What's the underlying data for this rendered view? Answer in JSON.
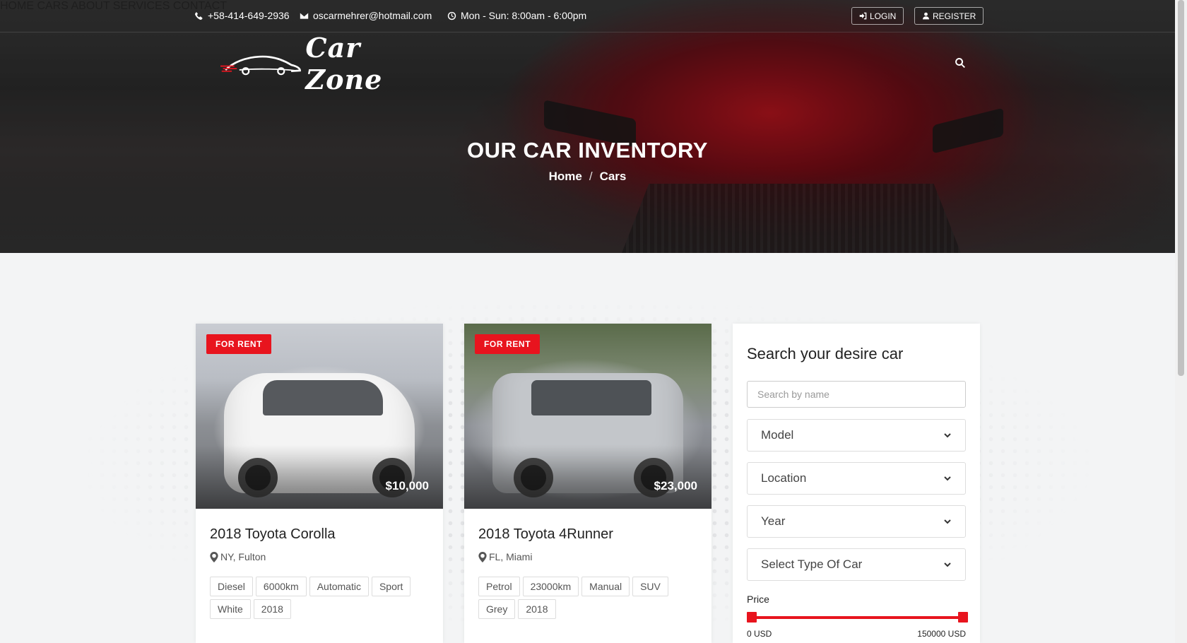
{
  "topbar": {
    "phone": "+58-414-649-2936",
    "email": "oscarmehrer@hotmail.com",
    "hours": "Mon - Sun: 8:00am - 6:00pm",
    "login_label": "LOGIN",
    "register_label": "REGISTER"
  },
  "brand": {
    "name": "Car Zone"
  },
  "nav": {
    "items": [
      "HOME",
      "CARS",
      "ABOUT",
      "SERVICES",
      "CONTACT"
    ]
  },
  "hero": {
    "title": "OUR CAR INVENTORY",
    "breadcrumb": [
      "Home",
      "Cars"
    ],
    "breadcrumb_separator": "/"
  },
  "cars": [
    {
      "badge": "FOR RENT",
      "price": "$10,000",
      "title": "2018 Toyota Corolla",
      "location": "NY, Fulton",
      "tags": [
        "Diesel",
        "6000km",
        "Automatic",
        "Sport",
        "White",
        "2018"
      ]
    },
    {
      "badge": "FOR RENT",
      "price": "$23,000",
      "title": "2018 Toyota 4Runner",
      "location": "FL, Miami",
      "tags": [
        "Petrol",
        "23000km",
        "Manual",
        "SUV",
        "Grey",
        "2018"
      ]
    }
  ],
  "search": {
    "heading": "Search your desire car",
    "name_placeholder": "Search by name",
    "model_selected": "Model",
    "location_selected": "Location",
    "year_selected": "Year",
    "type_selected": "Select Type Of Car",
    "price_label": "Price",
    "price_min_label": "0 USD",
    "price_max_label": "150000 USD",
    "price_min_fraction": 0,
    "price_max_fraction": 1
  },
  "colors": {
    "accent": "#e8141e",
    "panel_bg": "#ffffff",
    "page_bg": "#f3f4f5"
  }
}
